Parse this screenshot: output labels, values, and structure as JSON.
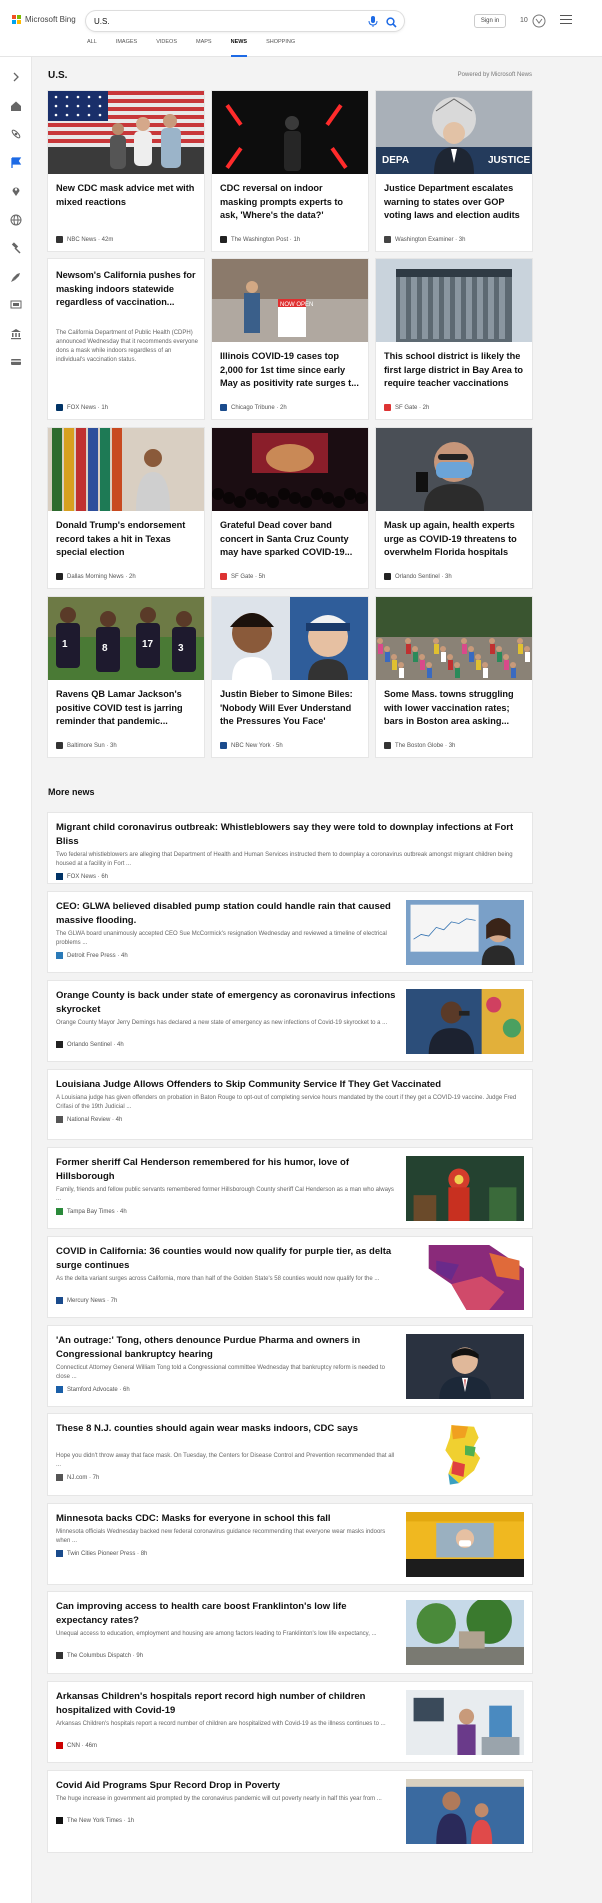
{
  "brand": {
    "name": "Microsoft Bing",
    "colors": [
      "#f25022",
      "#7fba00",
      "#00a4ef",
      "#ffb900"
    ]
  },
  "search": {
    "query": "U.S."
  },
  "header": {
    "signin": "Sign in",
    "rewards_count": "10"
  },
  "tabs": [
    {
      "label": "ALL",
      "active": false
    },
    {
      "label": "IMAGES",
      "active": false
    },
    {
      "label": "VIDEOS",
      "active": false
    },
    {
      "label": "MAPS",
      "active": false
    },
    {
      "label": "NEWS",
      "active": true
    },
    {
      "label": "SHOPPING",
      "active": false
    }
  ],
  "rail_icons": [
    "expand-icon",
    "home-icon",
    "science-icon",
    "flag-icon",
    "location-pin-icon",
    "globe-icon",
    "gavel-icon",
    "rocket-icon",
    "tv-icon",
    "bank-icon",
    "card-icon"
  ],
  "section": {
    "title": "U.S.",
    "powered": "Powered by Microsoft News"
  },
  "cards": [
    {
      "title": "New CDC mask advice met with mixed reactions",
      "desc": "",
      "source": "NBC News · 42m",
      "src_color": "#333",
      "img": "flag"
    },
    {
      "title": "CDC reversal on indoor masking prompts experts to ask, 'Where's the data?'",
      "desc": "",
      "source": "The Washington Post · 1h",
      "src_color": "#222",
      "img": "dark"
    },
    {
      "title": "Justice Department escalates warning to states over GOP voting laws and election audits",
      "desc": "",
      "source": "Washington Examiner · 3h",
      "src_color": "#444",
      "img": "justice"
    },
    {
      "title": "Newsom's California pushes for masking indoors statewide regardless of vaccination...",
      "desc": "The California Department of Public Health (CDPH) announced Wednesday that it recommends everyone dons a mask while indoors regardless of an individual's vaccination status.",
      "source": "FOX News · 1h",
      "src_color": "#003366",
      "img": ""
    },
    {
      "title": "Illinois COVID-19 cases top 2,000 for 1st time since early May as positivity rate surges t...",
      "desc": "",
      "source": "Chicago Tribune · 2h",
      "src_color": "#1a4b8c",
      "img": "street"
    },
    {
      "title": "This school district is likely the first large district in Bay Area to require teacher vaccinations",
      "desc": "",
      "source": "SF Gate · 2h",
      "src_color": "#d33",
      "img": "building"
    },
    {
      "title": "Donald Trump's endorsement record takes a hit in Texas special election",
      "desc": "",
      "source": "Dallas Morning News · 2h",
      "src_color": "#222",
      "img": "flags"
    },
    {
      "title": "Grateful Dead cover band concert in Santa Cruz County may have sparked COVID-19...",
      "desc": "",
      "source": "SF Gate · 5h",
      "src_color": "#d33",
      "img": "concert"
    },
    {
      "title": "Mask up again, health experts urge as COVID-19 threatens to overwhelm Florida hospitals",
      "desc": "",
      "source": "Orlando Sentinel · 3h",
      "src_color": "#222",
      "img": "mask"
    },
    {
      "title": "Ravens QB Lamar Jackson's positive COVID test is jarring reminder that pandemic...",
      "desc": "",
      "source": "Baltimore Sun · 3h",
      "src_color": "#333",
      "img": "football"
    },
    {
      "title": "Justin Bieber to Simone Biles: 'Nobody Will Ever Understand the Pressures You Face'",
      "desc": "",
      "source": "NBC New York · 5h",
      "src_color": "#1a4b8c",
      "img": "bieber"
    },
    {
      "title": "Some Mass. towns struggling with lower vaccination rates; bars in Boston area asking...",
      "desc": "",
      "source": "The Boston Globe · 3h",
      "src_color": "#333",
      "img": "crowd"
    }
  ],
  "more_title": "More news",
  "news": [
    {
      "title": "Migrant child coronavirus outbreak: Whistleblowers say they were told to downplay infections at Fort Bliss",
      "desc": "Two federal whistleblowers are alleging that Department of Health and Human Services instructed them to downplay a coronavirus outbreak amongst migrant children being housed at a facility in Fort ...",
      "source": "FOX News · 6h",
      "src_color": "#003366",
      "img": ""
    },
    {
      "title": "CEO: GLWA believed disabled pump station could handle rain that caused massive flooding.",
      "desc": "The GLWA board unanimously accepted CEO Sue McCormick's resignation Wednesday and reviewed a timeline of electrical problems ...",
      "source": "Detroit Free Press · 4h",
      "src_color": "#2a7ab8",
      "img": "glwa"
    },
    {
      "title": "Orange County is back under state of emergency as coronavirus infections skyrocket",
      "desc": "Orange County Mayor Jerry Demings has declared a new state of emergency as new infections of Covid-19 skyrocket to a ...",
      "source": "Orlando Sentinel · 4h",
      "src_color": "#222",
      "img": "demings"
    },
    {
      "title": "Louisiana Judge Allows Offenders to Skip Community Service If They Get Vaccinated",
      "desc": "A Louisiana judge has given offenders on probation in Baton Rouge to opt-out of completing service hours mandated by the court if they get a COVID-19 vaccine. Judge Fred Crifasi of the 19th Judicial ...",
      "source": "National Review · 4h",
      "src_color": "#555",
      "img": ""
    },
    {
      "title": "Former sheriff Cal Henderson remembered for his humor, love of Hillsborough",
      "desc": "Family, friends and fellow public servants remembered former Hillsborough County sheriff Cal Henderson as a man who always ...",
      "source": "Tampa Bay Times · 4h",
      "src_color": "#2a8a3a",
      "img": "sheriff"
    },
    {
      "title": "COVID in California: 36 counties would now qualify for purple tier, as delta surge continues",
      "desc": "As the delta variant surges across California, more than half of the Golden State's 58 counties would now qualify for the ...",
      "source": "Mercury News · 7h",
      "src_color": "#1a4b8c",
      "img": "camap"
    },
    {
      "title": "'An outrage:' Tong, others denounce Purdue Pharma and owners in Congressional bankruptcy hearing",
      "desc": "Connecticut Attorney General William Tong told a Congressional committee Wednesday that bankruptcy reform is needed to close ...",
      "source": "Stamford Advocate · 6h",
      "src_color": "#1a5fa8",
      "img": "tong"
    },
    {
      "title": "These 8 N.J. counties should again wear masks indoors, CDC says",
      "desc": "Hope you didn't throw away that face mask. On Tuesday, the Centers for Disease Control and Prevention recommended that all ...",
      "source": "NJ.com · 7h",
      "src_color": "#555",
      "img": "njmap"
    },
    {
      "title": "Minnesota backs CDC: Masks for everyone in school this fall",
      "desc": "Minnesota officials Wednesday backed new federal coronavirus guidance recommending that everyone wear masks indoors when ...",
      "source": "Twin Cities Pioneer Press · 8h",
      "src_color": "#1a4b8c",
      "img": "bus"
    },
    {
      "title": "Can improving access to health care boost Franklinton's low life expectancy rates?",
      "desc": "Unequal access to education, employment and housing are among factors leading to Franklinton's low life expectancy, ...",
      "source": "The Columbus Dispatch · 9h",
      "src_color": "#333",
      "img": "trees"
    },
    {
      "title": "Arkansas Children's hospitals report record high number of children hospitalized with Covid-19",
      "desc": "Arkansas Children's hospitals report a record number of children are hospitalized with Covid-19 as the illness continues to ...",
      "source": "CNN · 46m",
      "src_color": "#cc0000",
      "img": "hospital"
    },
    {
      "title": "Covid Aid Programs Spur Record Drop in Poverty",
      "desc": "The huge increase in government aid prompted by the coronavirus pandemic will cut poverty nearly in half this year from ...",
      "source": "The New York Times · 1h",
      "src_color": "#111",
      "img": "family"
    }
  ]
}
